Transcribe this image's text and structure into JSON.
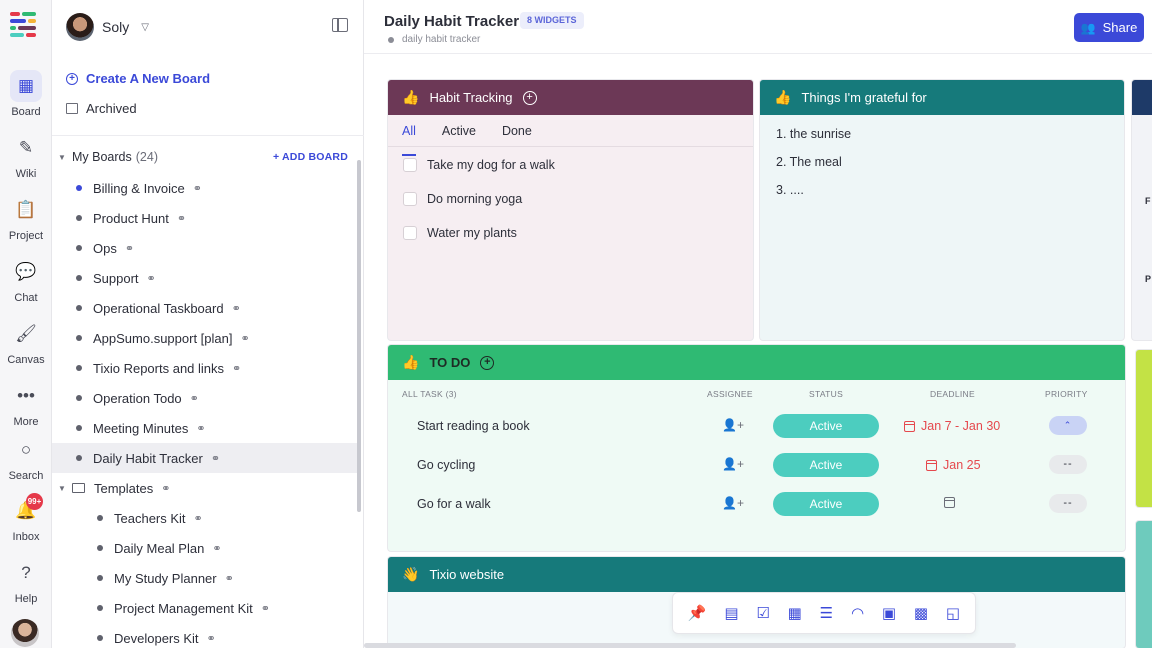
{
  "rail": {
    "items": [
      {
        "label": "Board",
        "icon": "board-icon",
        "glyph": "▦"
      },
      {
        "label": "Wiki",
        "icon": "pen-icon",
        "glyph": "✎"
      },
      {
        "label": "Project",
        "icon": "clipboard-icon",
        "glyph": "📋"
      },
      {
        "label": "Chat",
        "icon": "chat-icon",
        "glyph": "💬"
      },
      {
        "label": "Canvas",
        "icon": "brush-icon",
        "glyph": "🖌"
      },
      {
        "label": "More",
        "icon": "more-icon",
        "glyph": "•••"
      },
      {
        "label": "Search",
        "icon": "search-icon",
        "glyph": "○"
      },
      {
        "label": "Inbox",
        "icon": "bell-icon",
        "glyph": "🔔"
      },
      {
        "label": "Help",
        "icon": "help-icon",
        "glyph": "?"
      }
    ],
    "inbox_badge": "99+"
  },
  "sidebar": {
    "user_name": "Soly",
    "create_label": "Create A New Board",
    "archived_label": "Archived",
    "section_title": "My Boards",
    "section_count": "(24)",
    "add_board_label": "+ ADD BOARD",
    "boards": [
      {
        "label": "Billing & Invoice"
      },
      {
        "label": "Product Hunt"
      },
      {
        "label": "Ops"
      },
      {
        "label": "Support"
      },
      {
        "label": "Operational Taskboard"
      },
      {
        "label": "AppSumo.support [plan]"
      },
      {
        "label": "Tixio Reports and links"
      },
      {
        "label": "Operation Todo"
      },
      {
        "label": "Meeting Minutes"
      },
      {
        "label": "Daily Habit Tracker"
      }
    ],
    "templates_label": "Templates",
    "templates": [
      {
        "label": "Teachers Kit"
      },
      {
        "label": "Daily Meal Plan"
      },
      {
        "label": "My Study Planner"
      },
      {
        "label": "Project Management Kit"
      },
      {
        "label": "Developers Kit"
      }
    ]
  },
  "header": {
    "title": "Daily Habit Tracker",
    "widgets_badge": "8 WIDGETS",
    "subtitle": "daily habit tracker",
    "share_label": "Share"
  },
  "habit_card": {
    "title": "Habit Tracking",
    "tabs": [
      "All",
      "Active",
      "Done"
    ],
    "items": [
      "Take my dog for a walk",
      "Do morning yoga",
      "Water my plants"
    ]
  },
  "grateful_card": {
    "title": "Things I'm grateful for",
    "items": [
      "1. the sunrise",
      "2. The meal",
      "3. ...."
    ]
  },
  "partial_card": {
    "letters": [
      "F",
      "P"
    ]
  },
  "todo_card": {
    "title": "TO DO",
    "columns": {
      "task": "ALL TASK (3)",
      "assignee": "ASSIGNEE",
      "status": "STATUS",
      "deadline": "DEADLINE",
      "priority": "PRIORITY"
    },
    "rows": [
      {
        "task": "Start reading a book",
        "status": "Active",
        "deadline": "Jan 7 - Jan 30",
        "priority": "⌃"
      },
      {
        "task": "Go cycling",
        "status": "Active",
        "deadline": "Jan 25",
        "priority": "--"
      },
      {
        "task": "Go for a walk",
        "status": "Active",
        "deadline": "",
        "priority": "--"
      }
    ]
  },
  "tixio_card": {
    "title": "Tixio website"
  },
  "colors": {
    "accent": "#3b49d8",
    "habit_header": "#6c3856",
    "teal_header": "#167a7b",
    "todo_header": "#2fba73",
    "status_pill": "#4ccdbf",
    "deadline": "#e5484d"
  }
}
